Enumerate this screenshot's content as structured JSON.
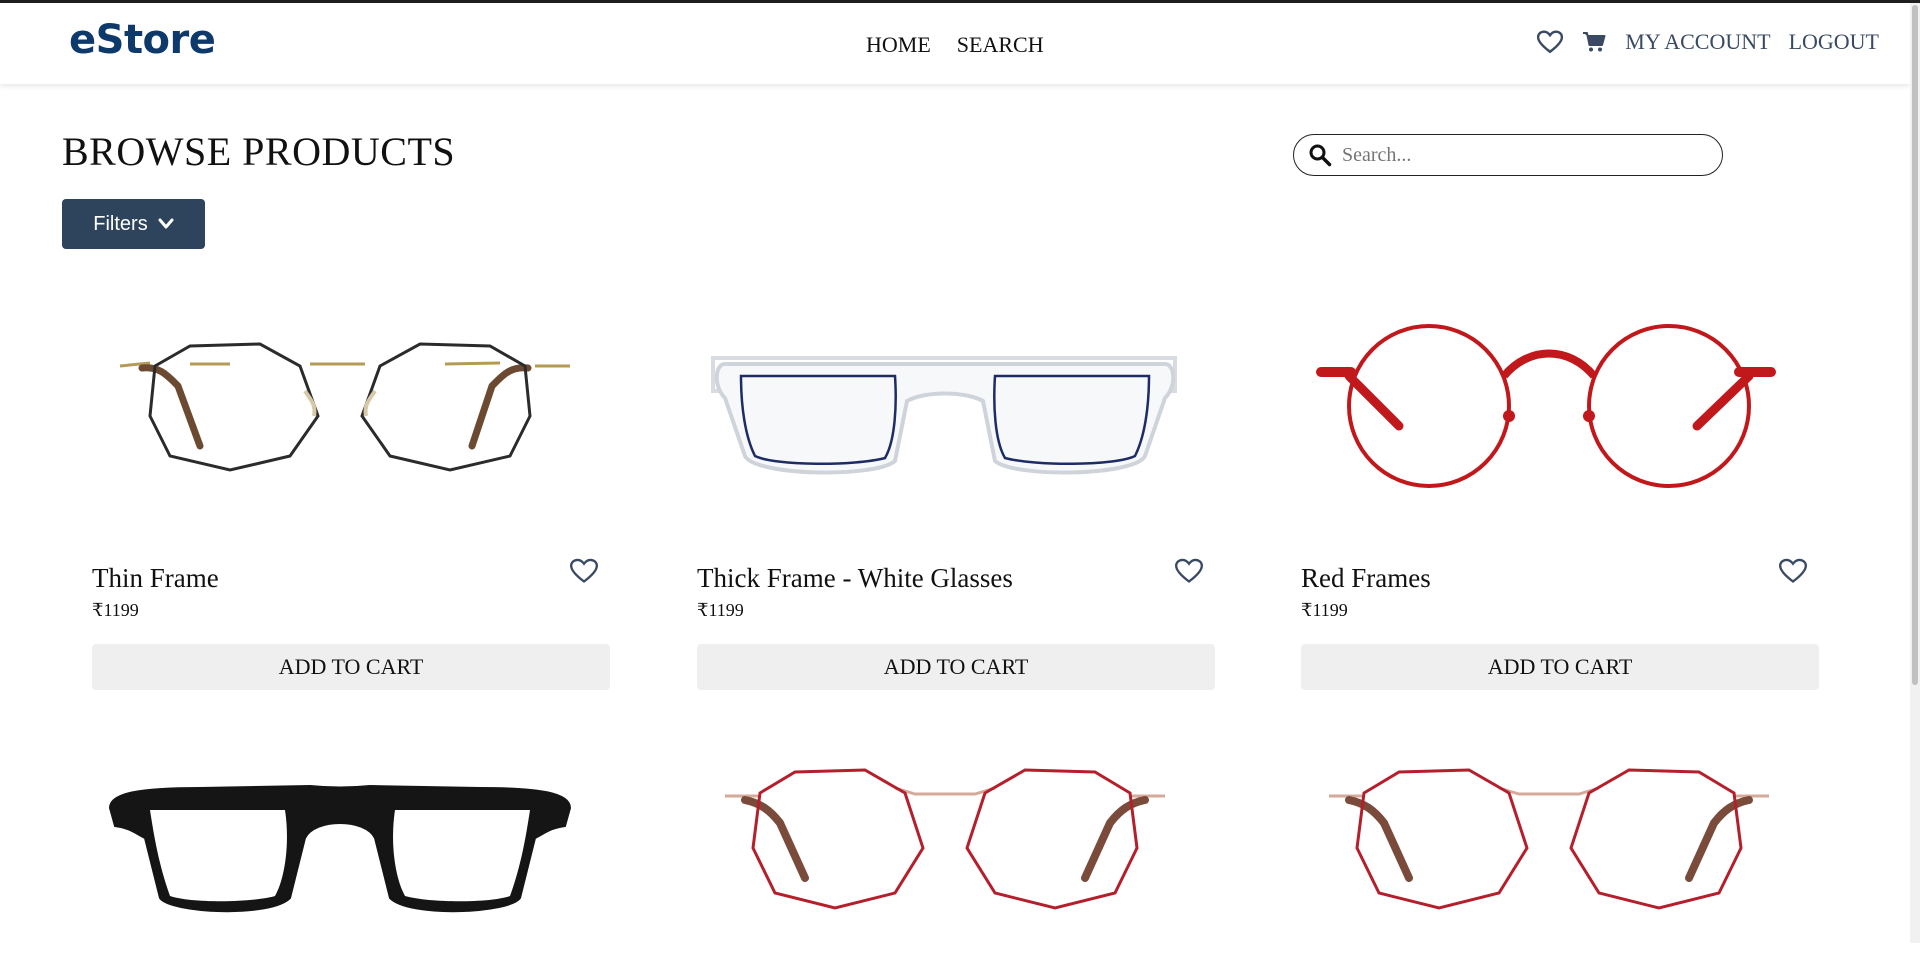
{
  "header": {
    "logo": "eStore",
    "nav": [
      "HOME",
      "SEARCH"
    ],
    "account": "MY ACCOUNT",
    "logout": "LOGOUT",
    "icons": [
      "heart-icon",
      "cart-icon"
    ]
  },
  "main": {
    "title": "BROWSE PRODUCTS",
    "search_placeholder": "Search...",
    "filters_label": "Filters",
    "add_label": "ADD TO CART"
  },
  "products": [
    {
      "name": "Thin Frame",
      "price": "₹1199",
      "frame_color": "#2b2b2b"
    },
    {
      "name": "Thick Frame - White Glasses",
      "price": "₹1199",
      "frame_color": "#d0d4da"
    },
    {
      "name": "Red Frames",
      "price": "₹1199",
      "frame_color": "#c0181b"
    },
    {
      "name": "",
      "price": "",
      "frame_color": "#151515"
    },
    {
      "name": "",
      "price": "",
      "frame_color": "#b51f2b"
    },
    {
      "name": "",
      "price": "",
      "frame_color": "#b51f2b"
    }
  ],
  "colors": {
    "brand": "#0e3a6b",
    "button": "#2e435c",
    "nav_right": "#3b4a63"
  }
}
